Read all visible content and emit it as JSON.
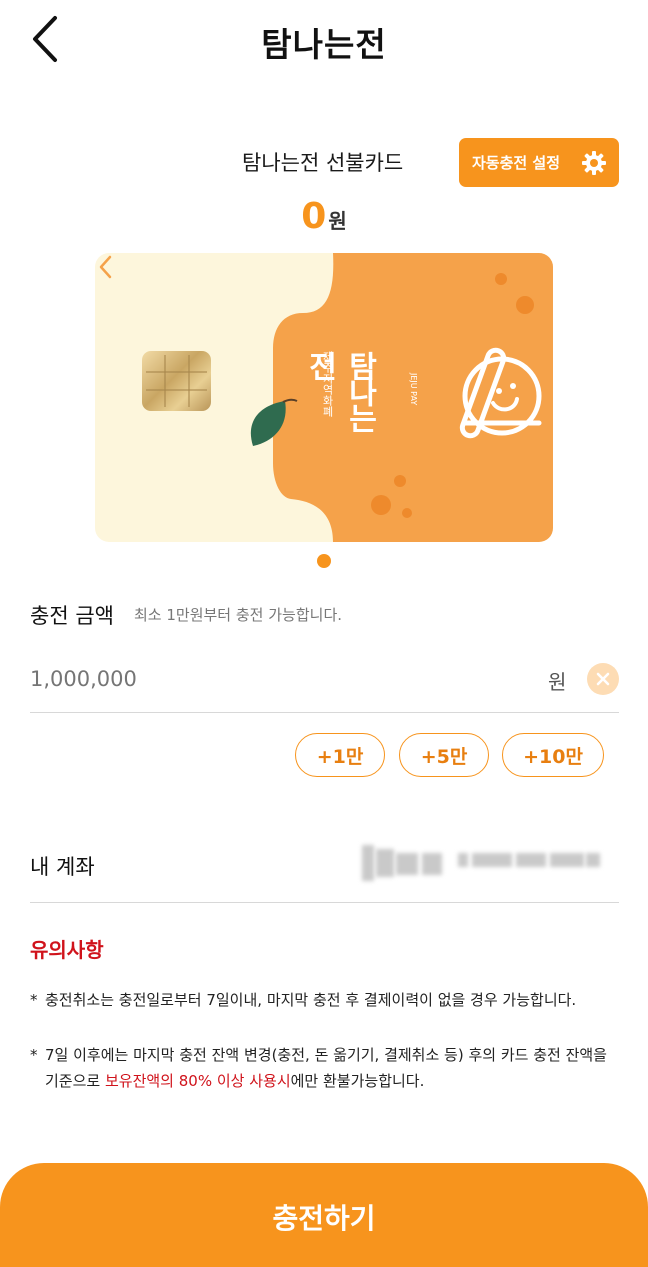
{
  "header": {
    "title": "탐나는전",
    "back_icon": "chevron-left-icon"
  },
  "card_section": {
    "card_name": "탐나는전 선불카드",
    "auto_charge_label": "자동충전 설정",
    "balance_amount": "0",
    "balance_unit": "원",
    "card_brand_vertical": "탐나는전",
    "card_sub_korean": "제주지역화폐",
    "card_sub_english": "JEJU PAY"
  },
  "charge": {
    "label": "충전 금액",
    "hint": "최소 1만원부터 충전 가능합니다.",
    "placeholder": "1,000,000",
    "unit": "원",
    "quick_buttons": [
      "+1만",
      "+5만",
      "+10만"
    ]
  },
  "account": {
    "label": "내 계좌"
  },
  "notice": {
    "title": "유의사항",
    "star": "*",
    "item1": "충전취소는 충전일로부터 7일이내, 마지막 충전 후 결제이력이 없을 경우 가능합니다.",
    "item2_pre": "7일 이후에는 마지막 충전 잔액 변경(충전, 돈 옮기기, 결제취소 등) 후의 카드 충전 잔액을 기준으로 ",
    "item2_highlight": "보유잔액의 80% 이상 사용시",
    "item2_post": "에만 환불가능합니다."
  },
  "submit_label": "충전하기",
  "colors": {
    "accent": "#f7941d",
    "warning": "#d0131b",
    "card_cream": "#fdf6dc",
    "card_orange": "#f5a24a"
  }
}
